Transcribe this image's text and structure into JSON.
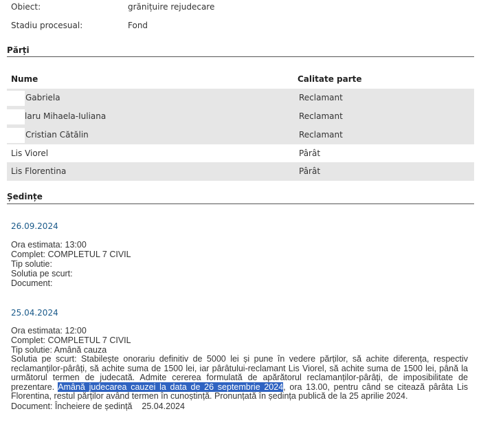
{
  "case": {
    "object_label": "Obiect:",
    "object_value": "grănițuire rejudecare",
    "stage_label": "Stadiu procesual:",
    "stage_value": "Fond"
  },
  "parties": {
    "title": "Părți",
    "col_name": "Nume",
    "col_role": "Calitate parte",
    "rows": [
      {
        "name": "Gabriela",
        "role": "Reclamant"
      },
      {
        "name": "laru Mihaela-Iuliana",
        "role": "Reclamant"
      },
      {
        "name": "Cristian Cătălin",
        "role": "Reclamant"
      },
      {
        "name": "Lis Viorel",
        "role": "Pârât"
      },
      {
        "name": "Lis Florentina",
        "role": "Pârât"
      }
    ]
  },
  "hearings": {
    "title": "Ședințe",
    "items": [
      {
        "date": "26.09.2024",
        "time": "Ora estimata: 13:00",
        "panel": "Complet: COMPLETUL 7 CIVIL",
        "type": "Tip solutie:",
        "summary": "Solutia pe scurt:",
        "document": "Document:"
      },
      {
        "date": "25.04.2024",
        "time": "Ora estimata: 12:00",
        "panel": "Complet: COMPLETUL 7 CIVIL",
        "type": "Tip solutie: Amână cauza",
        "summary_before": "Solutia pe scurt: Stabilește onorariu definitiv de 5000 lei și pune în vedere părților, să achite diferența, respectiv reclamanților-pârâți, să achite suma de 1500 lei, iar pârâtului-reclamant Lis Viorel, să achite suma de 1500 lei, până la următorul termen de judecată. Admite cererea formulată de apărătorul reclamanților-pârâți, de imposibilitate de prezentare. ",
        "summary_highlight": "Amână judecarea cauzei la data de 26 septembrie 2024",
        "summary_after": ", ora 13.00, pentru când se citează pârâta Lis Florentina, restul părților având termen în cunoștință. Pronunțată în ședința publică de la 25 aprilie 2024.",
        "document": "Document: Încheiere de ședință    25.04.2024"
      }
    ]
  },
  "colors": {
    "row_shade": "#e6e6e6",
    "date_link": "#1a5a8a",
    "highlight": "#2f63c1"
  }
}
